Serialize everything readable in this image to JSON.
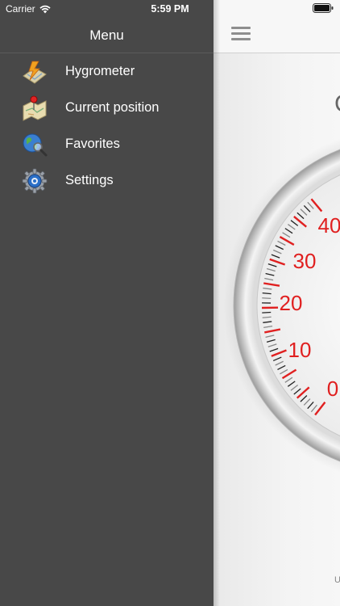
{
  "status_bar": {
    "carrier": "Carrier",
    "time": "5:59 PM"
  },
  "menu": {
    "title": "Menu",
    "items": [
      {
        "label": "Hygrometer",
        "icon": "hygrometer-icon"
      },
      {
        "label": "Current position",
        "icon": "map-pin-icon"
      },
      {
        "label": "Favorites",
        "icon": "globe-magnifier-icon"
      },
      {
        "label": "Settings",
        "icon": "gear-icon"
      }
    ]
  },
  "main": {
    "title_fragment": "C",
    "footer_fragment": "U",
    "gauge_labels": [
      "40",
      "30",
      "20",
      "10",
      "0"
    ],
    "accent_color": "#e02020"
  }
}
